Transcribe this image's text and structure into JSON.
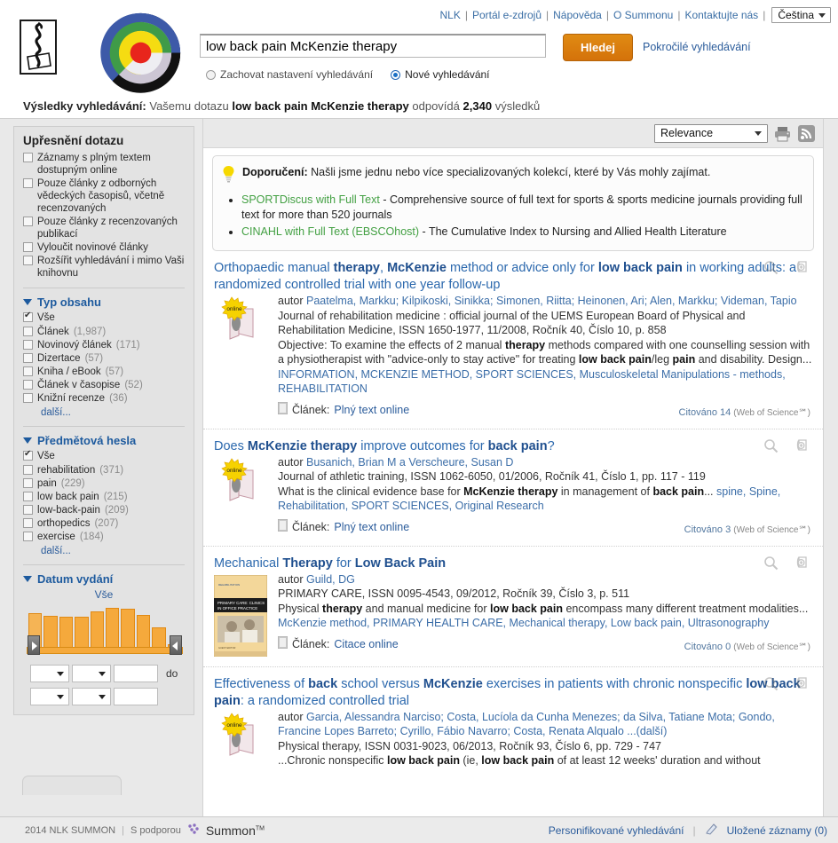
{
  "header": {
    "topnav": [
      {
        "label": "NLK"
      },
      {
        "label": "Portál e-zdrojů"
      },
      {
        "label": "Nápověda"
      },
      {
        "label": "O Summonu"
      },
      {
        "label": "Kontaktujte nás"
      }
    ],
    "language": "Čeština",
    "separator": "|"
  },
  "search": {
    "query": "low back pain McKenzie therapy",
    "placeholder": "",
    "button_label": "Hledej",
    "advanced_link": "Pokročilé vyhledávání",
    "radio_keep": "Zachovat nastavení vyhledávání",
    "radio_new": "Nové vyhledávání",
    "selected_radio": "new"
  },
  "results_line": {
    "lead": "Výsledky vyhledávání:",
    "mid": "Vašemu dotazu",
    "query": "low back pain McKenzie therapy",
    "after": "odpovídá",
    "count": "2,340",
    "unit": "výsledků"
  },
  "toolbar": {
    "sort_value": "Relevance",
    "print_icon": "printer-icon",
    "rss_icon": "rss-icon"
  },
  "sidebar": {
    "title": "Upřesnění dotazu",
    "top_filters": [
      {
        "label": "Záznamy s plným textem dostupným online",
        "checked": false
      },
      {
        "label": "Pouze články z odborných vědeckých časopisů, včetně recenzovaných",
        "checked": false
      },
      {
        "label": "Pouze články z recenzovaných publikací",
        "checked": false
      },
      {
        "label": "Vyloučit novinové články",
        "checked": false
      },
      {
        "label": "Rozšířit vyhledávání i mimo Vaši knihovnu",
        "checked": false
      }
    ],
    "content_type": {
      "heading": "Typ obsahu",
      "more_label": "další...",
      "items": [
        {
          "label": "Vše",
          "count": "",
          "checked": true
        },
        {
          "label": "Článek",
          "count": "(1,987)",
          "checked": false
        },
        {
          "label": "Novinový článek",
          "count": "(171)",
          "checked": false
        },
        {
          "label": "Dizertace",
          "count": "(57)",
          "checked": false
        },
        {
          "label": "Kniha / eBook",
          "count": "(57)",
          "checked": false
        },
        {
          "label": "Článek v časopise",
          "count": "(52)",
          "checked": false
        },
        {
          "label": "Knižní recenze",
          "count": "(36)",
          "checked": false
        }
      ]
    },
    "subjects": {
      "heading": "Předmětová hesla",
      "more_label": "další...",
      "items": [
        {
          "label": "Vše",
          "count": "",
          "checked": true
        },
        {
          "label": "rehabilitation",
          "count": "(371)",
          "checked": false
        },
        {
          "label": "pain",
          "count": "(229)",
          "checked": false
        },
        {
          "label": "low back pain",
          "count": "(215)",
          "checked": false
        },
        {
          "label": "low-back-pain",
          "count": "(209)",
          "checked": false
        },
        {
          "label": "orthopedics",
          "count": "(207)",
          "checked": false
        },
        {
          "label": "exercise",
          "count": "(184)",
          "checked": false
        }
      ]
    },
    "publication_date": {
      "heading": "Datum vydání",
      "all_label": "Vše",
      "to_label": "do",
      "from_month": "",
      "from_day": "",
      "from_year": "",
      "to_month": "",
      "to_day": "",
      "to_year": ""
    }
  },
  "chart_data": {
    "type": "bar",
    "title": "Datum vydání",
    "categories": [
      "b1",
      "b2",
      "b3",
      "b4",
      "b5",
      "b6",
      "b7",
      "b8",
      "b9",
      "b10"
    ],
    "values": [
      84,
      78,
      74,
      74,
      88,
      96,
      94,
      80,
      50,
      10
    ],
    "xlabel": "",
    "ylabel": "",
    "ylim": [
      0,
      100
    ],
    "grid": false,
    "highlighted_index": 0
  },
  "recommendation": {
    "icon": "lightbulb-icon",
    "label": "Doporučení:",
    "text": "Našli jsme jednu nebo více specializovaných kolekcí, které by Vás mohly zajímat.",
    "items": [
      {
        "link": "SPORTDiscus with Full Text",
        "desc": "- Comprehensive source of full text for sports & sports medicine journals providing full text for more than 520 journals"
      },
      {
        "link": "CINAHL with Full Text (EBSCOhost)",
        "desc": "- The Cumulative Index to Nursing and Allied Health Literature"
      }
    ]
  },
  "results": [
    {
      "title_parts": [
        {
          "t": "Orthopaedic manual ",
          "b": false
        },
        {
          "t": "therapy",
          "b": true
        },
        {
          "t": ", ",
          "b": false
        },
        {
          "t": "McKenzie",
          "b": true
        },
        {
          "t": " method or advice only for ",
          "b": false
        },
        {
          "t": "low back pain",
          "b": true
        },
        {
          "t": " in working adults: a randomized controlled trial with one year follow-up",
          "b": false
        }
      ],
      "thumb": "online-book",
      "author_label": "autor",
      "authors": "Paatelma, Markku; Kilpikoski, Sinikka; Simonen, Riitta; Heinonen, Ari; Alen, Markku; Videman, Tapio",
      "source": "Journal of rehabilitation medicine : official journal of the UEMS European Board of Physical and Rehabilitation Medicine, ISSN 1650-1977, 11/2008, Ročník 40, Číslo 10, p. 858",
      "snippet_parts": [
        {
          "t": "Objective: To examine the effects of 2 manual ",
          "b": false
        },
        {
          "t": "therapy",
          "b": true
        },
        {
          "t": " methods compared with one counselling session with a physiotherapist with \"advice-only to stay active\" for treating ",
          "b": false
        },
        {
          "t": "low back pain",
          "b": true
        },
        {
          "t": "/leg ",
          "b": false
        },
        {
          "t": "pain",
          "b": true
        },
        {
          "t": " and disability. Design...",
          "b": false
        }
      ],
      "subjects": " INFORMATION, MCKENZIE METHOD, SPORT SCIENCES, Musculoskeletal Manipulations - methods, REHABILITATION",
      "format_label": "Článek:",
      "format_link": "Plný text online",
      "cited": "Citováno 14",
      "cited_src": "(Web of Science℠)"
    },
    {
      "title_parts": [
        {
          "t": "Does ",
          "b": false
        },
        {
          "t": "McKenzie therapy",
          "b": true
        },
        {
          "t": " improve outcomes for ",
          "b": false
        },
        {
          "t": "back pain",
          "b": true
        },
        {
          "t": "?",
          "b": false
        }
      ],
      "thumb": "online-book",
      "author_label": "autor",
      "authors": "Busanich, Brian M a Verscheure, Susan D",
      "source": "Journal of athletic training, ISSN 1062-6050, 01/2006, Ročník 41, Číslo 1, pp. 117 - 119",
      "snippet_parts": [
        {
          "t": "What is the clinical evidence base for ",
          "b": false
        },
        {
          "t": "McKenzie therapy",
          "b": true
        },
        {
          "t": " in management of ",
          "b": false
        },
        {
          "t": "back pain",
          "b": true
        },
        {
          "t": "...",
          "b": false
        }
      ],
      "subjects": " spine, Spine, Rehabilitation, SPORT SCIENCES, Original Research",
      "format_label": "Článek:",
      "format_link": "Plný text online",
      "cited": "Citováno 3",
      "cited_src": "(Web of Science℠)"
    },
    {
      "title_parts": [
        {
          "t": "Mechanical ",
          "b": false
        },
        {
          "t": "Therapy",
          "b": true
        },
        {
          "t": " for ",
          "b": false
        },
        {
          "t": "Low Back Pain",
          "b": true
        }
      ],
      "thumb": "book-cover",
      "author_label": "autor",
      "authors": "Guild, DG",
      "source": "PRIMARY CARE, ISSN 0095-4543, 09/2012, Ročník 39, Číslo 3, p. 511",
      "snippet_parts": [
        {
          "t": "Physical ",
          "b": false
        },
        {
          "t": "therapy",
          "b": true
        },
        {
          "t": " and manual medicine for ",
          "b": false
        },
        {
          "t": "low back pain",
          "b": true
        },
        {
          "t": " encompass many different treatment modalities...",
          "b": false
        }
      ],
      "subjects": " McKenzie method, PRIMARY HEALTH CARE, Mechanical therapy, Low back pain, Ultrasonography",
      "format_label": "Článek:",
      "format_link": "Citace online",
      "cited": "Citováno 0",
      "cited_src": "(Web of Science℠)"
    },
    {
      "title_parts": [
        {
          "t": "Effectiveness of ",
          "b": false
        },
        {
          "t": "back",
          "b": true
        },
        {
          "t": " school versus ",
          "b": false
        },
        {
          "t": "McKenzie",
          "b": true
        },
        {
          "t": " exercises in patients with chronic nonspecific ",
          "b": false
        },
        {
          "t": "low back pain",
          "b": true
        },
        {
          "t": ": a randomized controlled trial",
          "b": false
        }
      ],
      "thumb": "online-book",
      "author_label": "autor",
      "authors": "Garcia, Alessandra Narciso; Costa, Lucíola da Cunha Menezes; da Silva, Tatiane Mota; Gondo, Francine Lopes Barreto; Cyrillo, Fábio Navarro; Costa, Renata Alqualo ...(další)",
      "source": "Physical therapy, ISSN 0031-9023, 06/2013, Ročník 93, Číslo 6, pp. 729 - 747",
      "snippet_parts": [
        {
          "t": "...Chronic nonspecific ",
          "b": false
        },
        {
          "t": "low back pain",
          "b": true
        },
        {
          "t": " (ie, ",
          "b": false
        },
        {
          "t": "low back pain",
          "b": true
        },
        {
          "t": " of at least 12 weeks' duration and without",
          "b": false
        }
      ],
      "subjects": "",
      "format_label": "",
      "format_link": "",
      "cited": "",
      "cited_src": ""
    }
  ],
  "book_cover": {
    "top_small": "REHABILITATION",
    "title_line1": "PRIMARY CARE: CLINICS",
    "title_line2": "IN OFFICE PRACTICE",
    "footer_text": "GUEST EDITOR"
  },
  "footer": {
    "copyright": "2014 NLK SUMMON",
    "powered_by": "S podporou",
    "brand": "Summon",
    "brand_tm": "TM",
    "personalized": "Personifikované vyhledávání",
    "saved_records": "Uložené záznamy (0)",
    "saved_icon": "bookmark-icon"
  },
  "colors": {
    "accent_orange": "#d4720a",
    "link_blue": "#2b5c9b",
    "heading_blue": "#1d5a9e",
    "green_link": "#43a043",
    "bar_orange": "#f5a93c"
  }
}
